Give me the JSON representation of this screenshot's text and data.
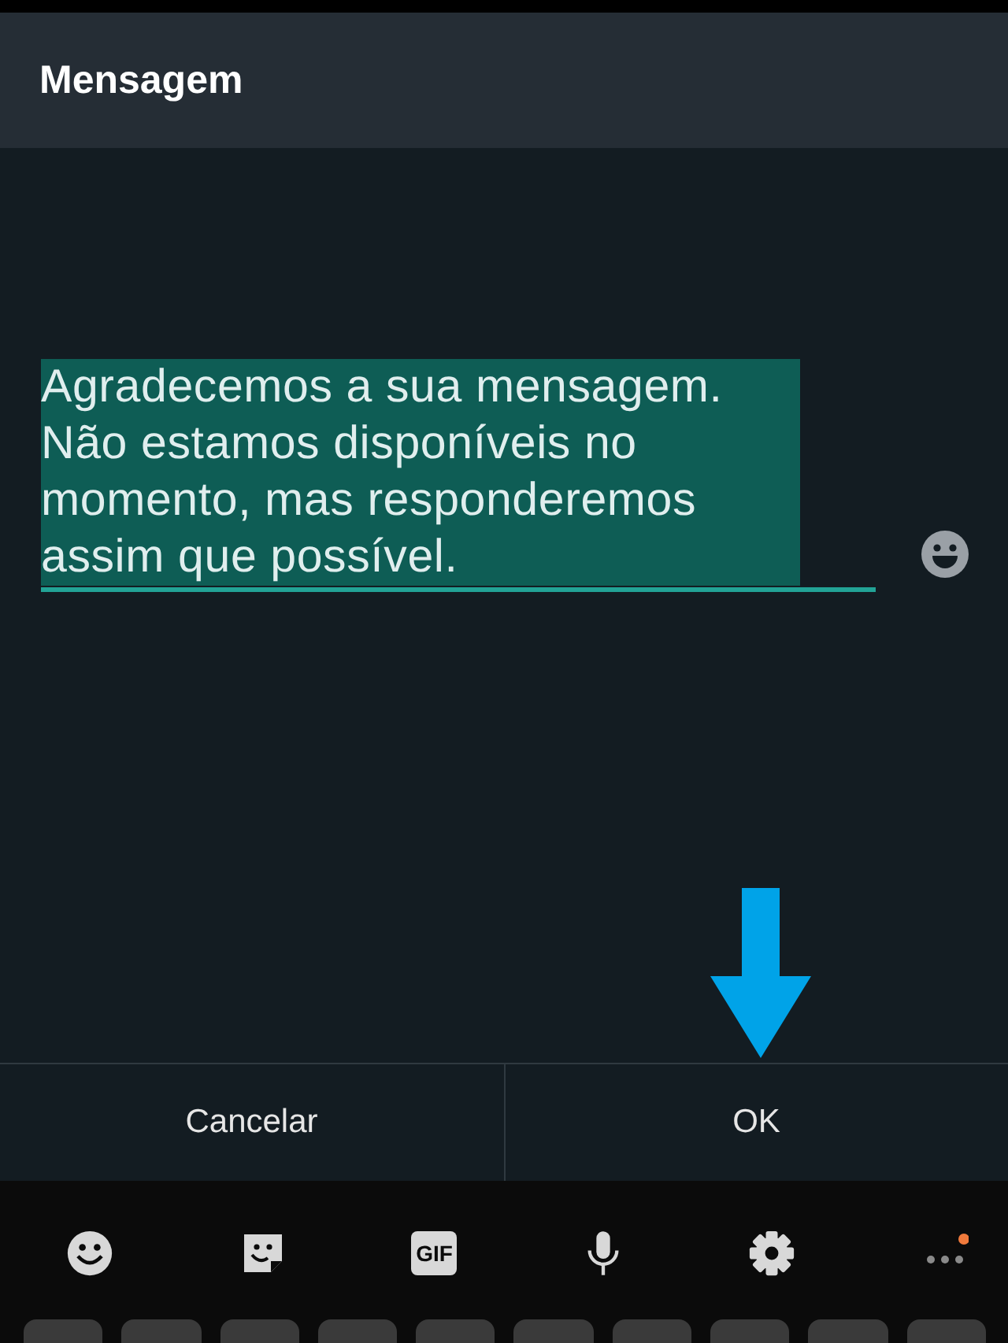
{
  "dialog": {
    "title": "Mensagem"
  },
  "field": {
    "value": "Agradecemos a sua mensagem. Não estamos disponíveis no momento, mas responderemos assim que possível.",
    "selected": true
  },
  "buttons": [
    {
      "label": "Cancelar"
    },
    {
      "label": "OK"
    }
  ],
  "keyboard_toolbar": [
    {
      "kind": "emoji"
    },
    {
      "kind": "sticker"
    },
    {
      "kind": "gif",
      "label": "GIF"
    },
    {
      "kind": "mic"
    },
    {
      "kind": "settings"
    },
    {
      "kind": "more",
      "badge": true
    }
  ]
}
